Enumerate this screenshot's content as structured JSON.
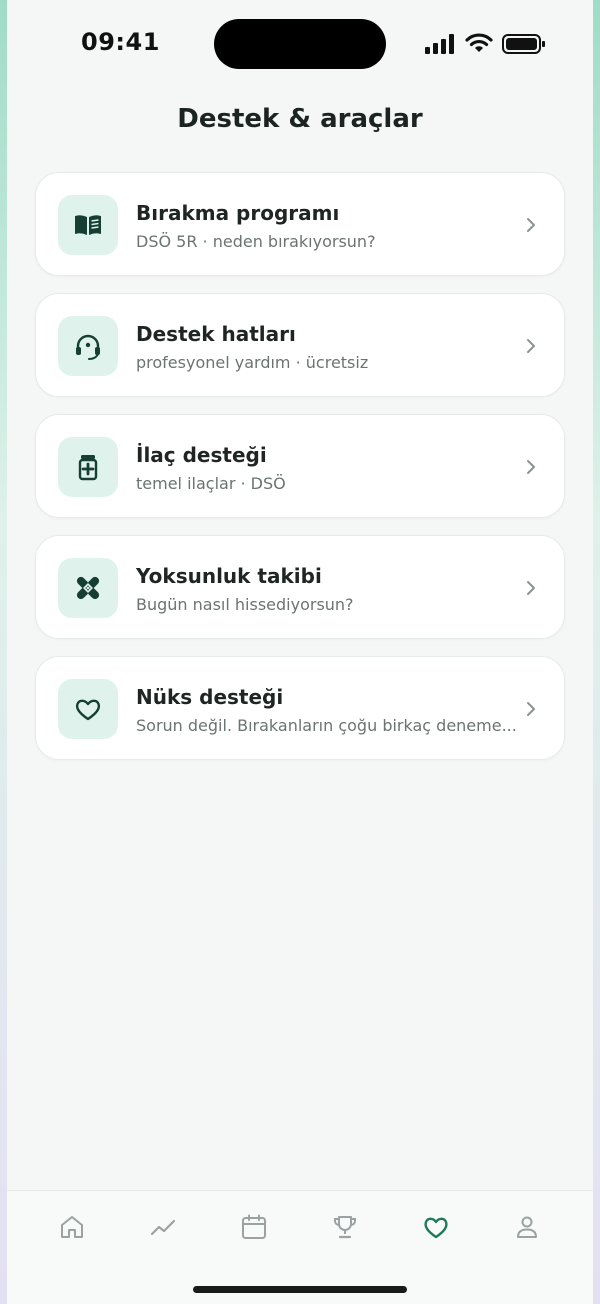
{
  "status_bar": {
    "time": "09:41"
  },
  "header": {
    "title": "Destek & araçlar"
  },
  "cards": [
    {
      "title": "Bırakma programı",
      "subtitle": "DSÖ 5R · neden bırakıyorsun?",
      "icon": "book-icon"
    },
    {
      "title": "Destek hatları",
      "subtitle": "profesyonel yardım · ücretsiz",
      "icon": "headset-icon"
    },
    {
      "title": "İlaç desteği",
      "subtitle": "temel ilaçlar · DSÖ",
      "icon": "medicine-icon"
    },
    {
      "title": "Yoksunluk takibi",
      "subtitle": "Bugün nasıl hissediyorsun?",
      "icon": "bandage-icon"
    },
    {
      "title": "Nüks desteği",
      "subtitle": "Sorun değil. Bırakanların çoğu birkaç deneme...",
      "icon": "heart-icon"
    }
  ],
  "tab_bar": {
    "tabs": [
      "home-icon",
      "trend-icon",
      "calendar-icon",
      "trophy-icon",
      "heart-icon",
      "profile-icon"
    ],
    "active": "heart-icon"
  },
  "colors": {
    "accent": "#1f7a5c",
    "icon_dark": "#163f33",
    "icon_bg": "#dff3ec",
    "inactive": "#9aa3a1"
  }
}
